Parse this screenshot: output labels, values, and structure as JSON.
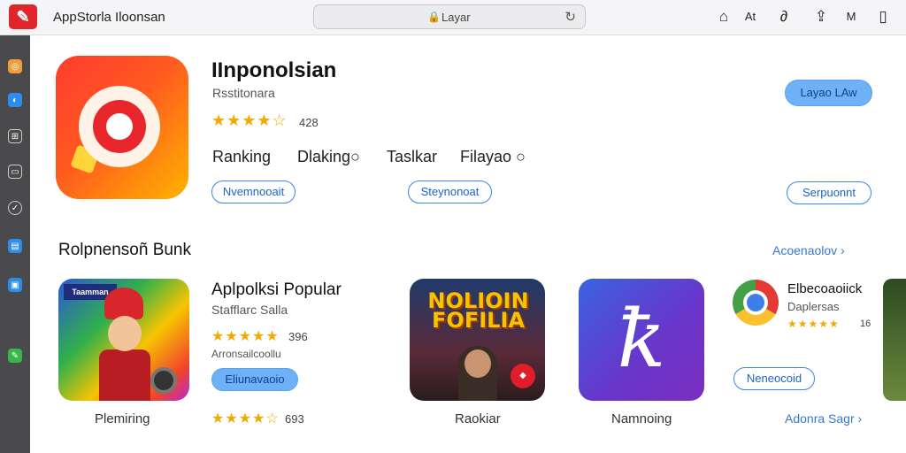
{
  "topbar": {
    "app_title": "AppStorla Iloonsan",
    "address": "Layar",
    "right_icons": [
      "home-icon",
      "text-icon",
      "link-icon",
      "share-icon",
      "menu-icon",
      "sidebar-icon"
    ],
    "text_icon_label": "At",
    "menu_icon_label": "M"
  },
  "sidebar": {
    "items": [
      {
        "icon": "orange-app-icon",
        "color": "#f39c3a"
      },
      {
        "icon": "blue-app-icon",
        "color": "#2d8cf0"
      },
      {
        "icon": "grid-icon",
        "color": "#6d6d70"
      },
      {
        "icon": "window-icon",
        "color": "#6d6d70"
      },
      {
        "icon": "check-icon",
        "color": "#6d6d70"
      },
      {
        "icon": "doc-icon",
        "color": "#2d8cf0"
      },
      {
        "icon": "photo-icon",
        "color": "#2d8cf0"
      },
      {
        "icon": "pen-icon",
        "color": "#3ab54a"
      }
    ]
  },
  "hero": {
    "name": "IInponolsian",
    "subtitle": "Rsstitonara",
    "rating_stars": "★★★★☆",
    "rating_value": 4.5,
    "rating_count": "428",
    "action_button": "Layao LAw",
    "tabs": [
      "Ranking",
      "Dlaking○",
      "Taslkar",
      "Filayao ○"
    ],
    "pills": [
      "Nvemnooait",
      "Steynonoat",
      "Serpuonnt"
    ]
  },
  "section": {
    "title": "Rolpnensoñ Bunk",
    "see_all": "Acoenaolov"
  },
  "cards": {
    "card1": {
      "banner": "Taamman",
      "label": "Plemiring",
      "name": "Aplpolksi Popular",
      "subtitle": "Stafflarc Salla",
      "stars": "★★★★★",
      "rating": 5,
      "count": "396",
      "caption": "Arronsailcoollu",
      "button": "Eliunavaoio",
      "stars_bottom": "★★★★☆",
      "rating_bottom": 4.5,
      "count_bottom": "693"
    },
    "card2": {
      "poster_title": "NOLIOIN FOFILIA",
      "label": "Raokiar"
    },
    "card3": {
      "label": "Namnoing"
    },
    "card4": {
      "name": "Elbecoaoiick",
      "subtitle": "Daplersas",
      "stars": "★★★★★",
      "rating": 5,
      "count": "16",
      "button": "Neneocoid",
      "link": "Adonra Sagr"
    }
  },
  "colors": {
    "accent": "#3478d6",
    "star": "#f2a900",
    "sidebar_bg": "#4a4a4c",
    "brand_red": "#e0262b"
  }
}
